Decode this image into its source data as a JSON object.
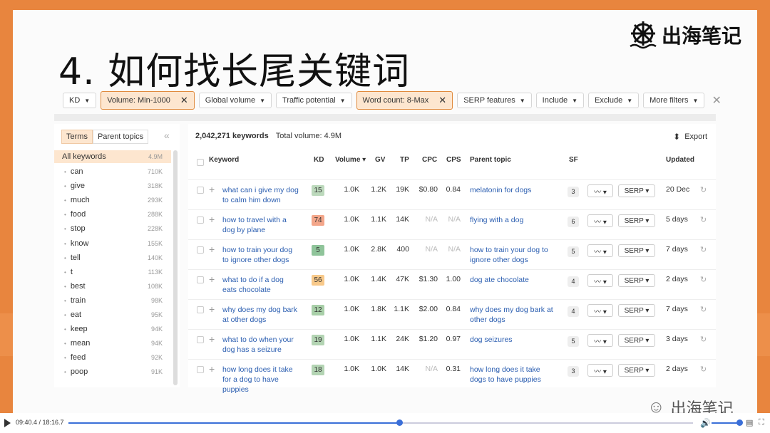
{
  "slide": {
    "title": "4. 如何找长尾关键词",
    "logo_text": "出海笔记",
    "watermark": "出海笔记"
  },
  "filters": [
    {
      "label": "KD",
      "active": false
    },
    {
      "label": "Volume: Min-1000",
      "active": true
    },
    {
      "label": "Global volume",
      "active": false
    },
    {
      "label": "Traffic potential",
      "active": false
    },
    {
      "label": "Word count: 8-Max",
      "active": true
    },
    {
      "label": "SERP features",
      "active": false
    },
    {
      "label": "Include",
      "active": false
    },
    {
      "label": "Exclude",
      "active": false
    },
    {
      "label": "More filters",
      "active": false
    }
  ],
  "sidebar": {
    "tab_terms": "Terms",
    "tab_parent": "Parent topics",
    "all_label": "All keywords",
    "all_count": "4.9M",
    "items": [
      {
        "term": "can",
        "count": "710K"
      },
      {
        "term": "give",
        "count": "318K"
      },
      {
        "term": "much",
        "count": "293K"
      },
      {
        "term": "food",
        "count": "288K"
      },
      {
        "term": "stop",
        "count": "228K"
      },
      {
        "term": "know",
        "count": "155K"
      },
      {
        "term": "tell",
        "count": "140K"
      },
      {
        "term": "t",
        "count": "113K"
      },
      {
        "term": "best",
        "count": "108K"
      },
      {
        "term": "train",
        "count": "98K"
      },
      {
        "term": "eat",
        "count": "95K"
      },
      {
        "term": "keep",
        "count": "94K"
      },
      {
        "term": "mean",
        "count": "94K"
      },
      {
        "term": "feed",
        "count": "92K"
      },
      {
        "term": "poop",
        "count": "91K"
      }
    ]
  },
  "summary": {
    "keywords": "2,042,271 keywords",
    "total_volume": "Total volume: 4.9M",
    "export": "Export"
  },
  "columns": {
    "keyword": "Keyword",
    "kd": "KD",
    "volume": "Volume ▾",
    "gv": "GV",
    "tp": "TP",
    "cpc": "CPC",
    "cps": "CPS",
    "parent": "Parent topic",
    "sf": "SF",
    "updated": "Updated"
  },
  "rows": [
    {
      "kw1": "what can i give my dog",
      "kw2": "to calm him down",
      "kw3": "",
      "kd": "15",
      "kd_color": "#bcd9bc",
      "vol": "1.0K",
      "gv": "1.2K",
      "tp": "19K",
      "cpc": "$0.80",
      "cps": "0.84",
      "pt1": "melatonin for dogs",
      "pt2": "",
      "sf": "3",
      "serp": "SERP ▾",
      "upd": "20 Dec"
    },
    {
      "kw1": "how to travel with a",
      "kw2": "dog by plane",
      "kw3": "",
      "kd": "74",
      "kd_color": "#f3a68a",
      "vol": "1.0K",
      "gv": "1.1K",
      "tp": "14K",
      "cpc": "N/A",
      "cps": "N/A",
      "pt1": "flying with a dog",
      "pt2": "",
      "sf": "6",
      "serp": "SERP ▾",
      "upd": "5 days"
    },
    {
      "kw1": "how to train your dog",
      "kw2": "to ignore other dogs",
      "kw3": "",
      "kd": "5",
      "kd_color": "#8fc49a",
      "vol": "1.0K",
      "gv": "2.8K",
      "tp": "400",
      "cpc": "N/A",
      "cps": "N/A",
      "pt1": "how to train your dog to",
      "pt2": "ignore other dogs",
      "sf": "5",
      "serp": "SERP ▾",
      "upd": "7 days"
    },
    {
      "kw1": "what to do if a dog",
      "kw2": "eats chocolate",
      "kw3": "",
      "kd": "56",
      "kd_color": "#f8c98a",
      "vol": "1.0K",
      "gv": "1.4K",
      "tp": "47K",
      "cpc": "$1.30",
      "cps": "1.00",
      "pt1": "dog ate chocolate",
      "pt2": "",
      "sf": "4",
      "serp": "SERP ▾",
      "upd": "2 days"
    },
    {
      "kw1": "why does my dog bark",
      "kw2": "at other dogs",
      "kw3": "",
      "kd": "12",
      "kd_color": "#a8cfa8",
      "vol": "1.0K",
      "gv": "1.8K",
      "tp": "1.1K",
      "cpc": "$2.00",
      "cps": "0.84",
      "pt1": "why does my dog bark at",
      "pt2": "other dogs",
      "sf": "4",
      "serp": "SERP ▾",
      "upd": "7 days"
    },
    {
      "kw1": "what to do when your",
      "kw2": "dog has a seizure",
      "kw3": "",
      "kd": "19",
      "kd_color": "#b3d4b3",
      "vol": "1.0K",
      "gv": "1.1K",
      "tp": "24K",
      "cpc": "$1.20",
      "cps": "0.97",
      "pt1": "dog seizures",
      "pt2": "",
      "sf": "5",
      "serp": "SERP ▾",
      "upd": "3 days"
    },
    {
      "kw1": "how long does it take",
      "kw2": "for a dog to have",
      "kw3": "puppies",
      "kd": "18",
      "kd_color": "#b3d4b3",
      "vol": "1.0K",
      "gv": "1.0K",
      "tp": "14K",
      "cpc": "N/A",
      "cps": "0.31",
      "pt1": "how long does it take",
      "pt2": "dogs to have puppies",
      "sf": "3",
      "serp": "SERP ▾",
      "upd": "2 days"
    }
  ],
  "player": {
    "time": "09:40.4 / 18:16.7",
    "progress": 0.53
  }
}
